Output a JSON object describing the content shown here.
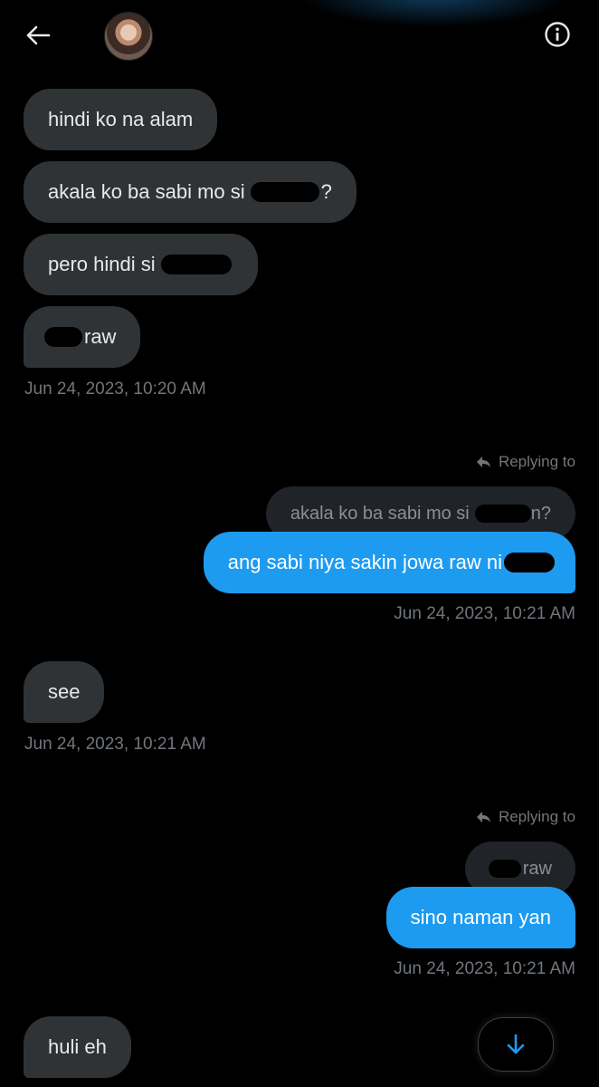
{
  "header": {
    "back_icon": "arrow-left-icon",
    "info_icon": "info-icon"
  },
  "messages": {
    "m1": "hindi ko na alam",
    "m2_pre": "akala ko ba sabi mo si",
    "m2_post": "?",
    "m3_pre": "pero hindi si",
    "m4_post": "raw",
    "ts1": "Jun 24, 2023, 10:20 AM",
    "reply1_label": "Replying to",
    "quote1_pre": "akala ko ba sabi mo si",
    "quote1_post": "n?",
    "out1_pre": "ang sabi niya sakin jowa raw ni",
    "ts2": "Jun 24, 2023, 10:21 AM",
    "m5": "see",
    "ts3": "Jun 24, 2023, 10:21 AM",
    "reply2_label": "Replying to",
    "quote2_post": "raw",
    "out2": "sino naman yan",
    "ts4": "Jun 24, 2023, 10:21 AM",
    "m6": "huli eh"
  },
  "colors": {
    "accent": "#1d9bf0",
    "incoming": "#2f3336",
    "timestamp": "#71767b"
  }
}
